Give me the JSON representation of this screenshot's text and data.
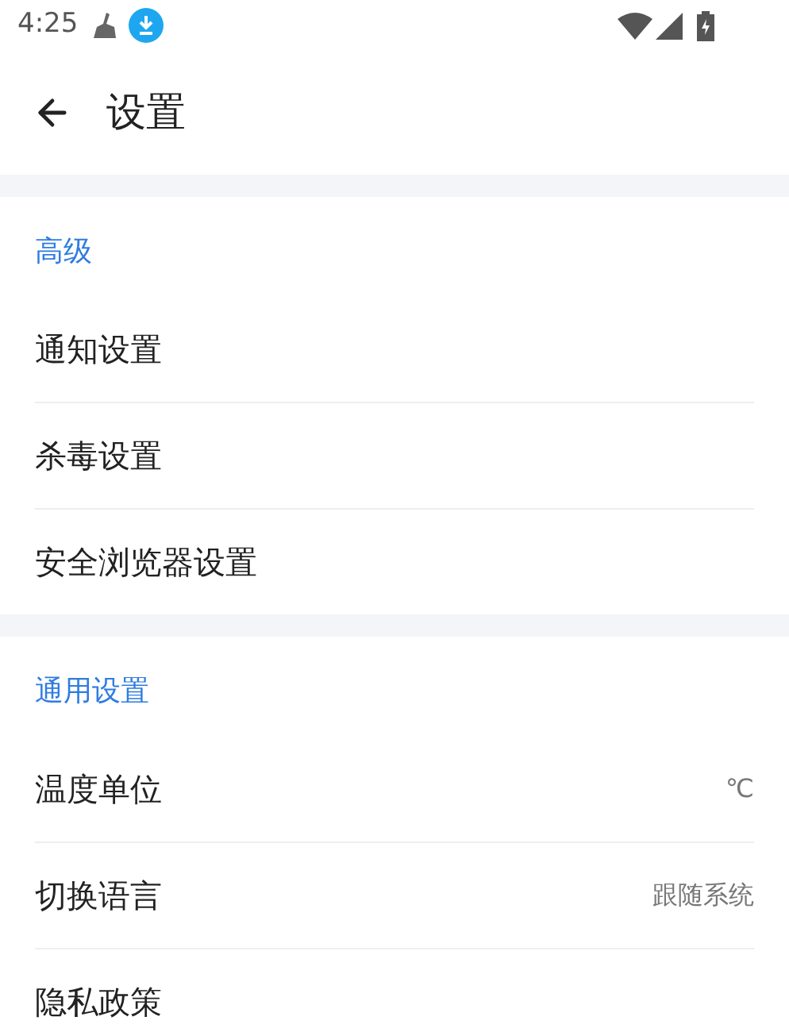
{
  "status_bar": {
    "time": "4:25"
  },
  "header": {
    "title": "设置"
  },
  "sections": [
    {
      "title": "高级",
      "items": [
        {
          "label": "通知设置"
        },
        {
          "label": "杀毒设置"
        },
        {
          "label": "安全浏览器设置"
        }
      ]
    },
    {
      "title": "通用设置",
      "items": [
        {
          "label": "温度单位",
          "value": "℃"
        },
        {
          "label": "切换语言",
          "value": "跟随系统"
        },
        {
          "label": "隐私政策"
        }
      ]
    }
  ]
}
